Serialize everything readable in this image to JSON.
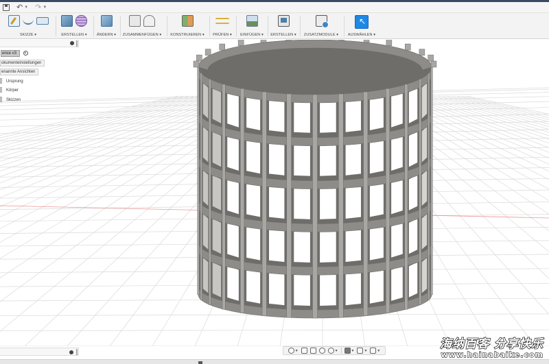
{
  "toolbar": {
    "groups": [
      {
        "id": "skizze",
        "label": "SKIZZE ▾"
      },
      {
        "id": "erstellen",
        "label": "ERSTELLEN ▾"
      },
      {
        "id": "aendern",
        "label": "ÄNDERN ▾"
      },
      {
        "id": "zusammenfuegen",
        "label": "ZUSAMMENFÜGEN ▾"
      },
      {
        "id": "konstruieren",
        "label": "KONSTRUIEREN ▾"
      },
      {
        "id": "pruefen",
        "label": "PRÜFEN ▾"
      },
      {
        "id": "einfuegen",
        "label": "EINFÜGEN ▾"
      },
      {
        "id": "erstellen2",
        "label": "ERSTELLEN ▾"
      },
      {
        "id": "zusatzmodule",
        "label": "ZUSATZMODULE ▾"
      },
      {
        "id": "auswaehlen",
        "label": "AUSWÄHLEN ▾"
      }
    ]
  },
  "browser": {
    "root": "ence v3",
    "nodes": [
      {
        "label": "okumenteinstellungen"
      },
      {
        "label": "enannte Ansichten"
      }
    ],
    "children": [
      {
        "label": "Ursprung"
      },
      {
        "label": "Körper"
      },
      {
        "label": "Skizzen"
      }
    ]
  },
  "watermark": {
    "line1": "海纳百客 分享快乐",
    "line2": "www.hainabaike.com"
  },
  "colors": {
    "model_face": "#8e8c89",
    "model_dark": "#6f6d6a",
    "model_light": "#a9a7a4",
    "grid": "#d9d9d9",
    "axis_x": "#e36a6a",
    "select_accent": "#1e88e5"
  }
}
